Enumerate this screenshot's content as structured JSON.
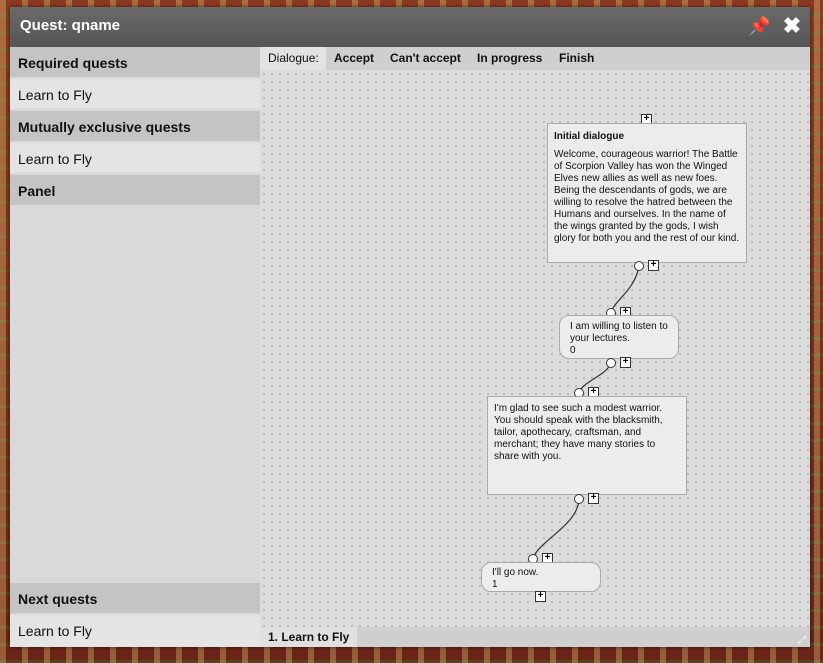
{
  "window": {
    "title": "Quest: qname"
  },
  "sections": {
    "required": {
      "header": "Required quests",
      "item": "Learn to Fly"
    },
    "exclusive": {
      "header": "Mutually exclusive quests",
      "item": "Learn to Fly"
    },
    "panel": {
      "header": "Panel"
    },
    "next": {
      "header": "Next quests",
      "item": "Learn to Fly"
    }
  },
  "tabs": {
    "label": "Dialogue:",
    "accept": "Accept",
    "cant_accept": "Can't accept",
    "in_progress": "In progress",
    "finish": "Finish"
  },
  "nodes": {
    "initial": {
      "heading": "Initial dialogue",
      "text": "Welcome, courageous warrior! The Battle of Scorpion Valley has won the Winged Elves new allies as well as new foes. Being the descendants of gods, we are willing to resolve the hatred between the Humans and ourselves. In the name of the wings granted by the gods, I wish glory for both you and the rest of our kind."
    },
    "answer1": {
      "text": "I am willing to listen to your lectures.",
      "num": "0"
    },
    "npc2": {
      "text": "I'm glad to see such a modest warrior. You should speak with the blacksmith, tailor, apothecary, craftsman, and merchant; they have many stories to share with you."
    },
    "answer2": {
      "text": "I'll go now.",
      "num": "1"
    }
  },
  "bottom_tab": "1. Learn to Fly",
  "icons": {
    "pin": "pin-icon",
    "close": "close-icon",
    "plus": "plus-icon",
    "resize": "resize-icon"
  }
}
